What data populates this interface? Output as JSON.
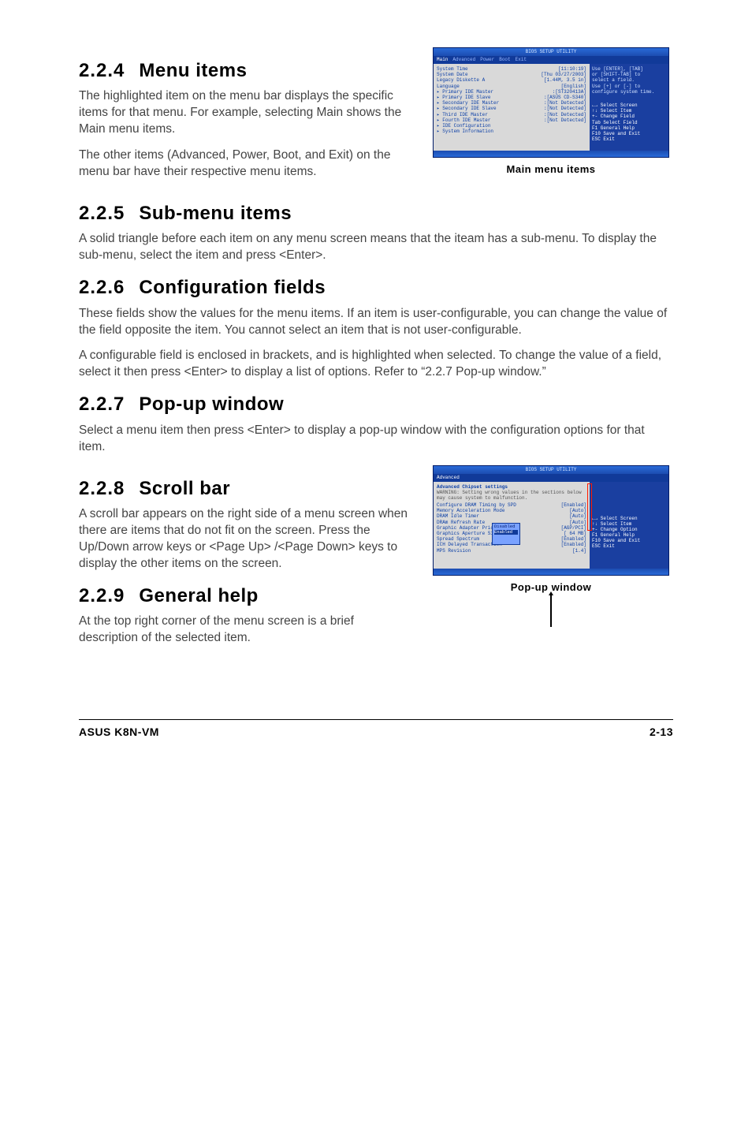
{
  "sections": {
    "s224": {
      "num": "2.2.4",
      "title": "Menu items",
      "p1": "The highlighted item on the menu bar displays the specific items for that menu. For example, selecting Main shows the Main menu items.",
      "p2": "The other items (Advanced, Power, Boot, and Exit) on the menu bar have their respective menu items."
    },
    "s225": {
      "num": "2.2.5",
      "title": "Sub-menu items",
      "p1": "A solid triangle before each item on any menu screen means that the iteam has a sub-menu. To display the sub-menu, select the item and press <Enter>."
    },
    "s226": {
      "num": "2.2.6",
      "title": "Configuration fields",
      "p1": "These fields show the values for the menu items. If an item is user-configurable, you can change the value of the field opposite the item. You cannot select an item that is not user-configurable.",
      "p2": "A configurable field is enclosed in brackets, and is highlighted when selected. To change the value of a field, select it then press <Enter> to display a list of options. Refer to “2.2.7 Pop-up window.”"
    },
    "s227": {
      "num": "2.2.7",
      "title": "Pop-up window",
      "p1": "Select a menu item then press <Enter> to display a pop-up window with the configuration options for that item."
    },
    "s228": {
      "num": "2.2.8",
      "title": "Scroll bar",
      "p1": "A scroll bar appears on the right side of a menu screen when there are items that do not fit on the screen. Press the Up/Down arrow keys or <Page Up> /<Page Down> keys to display the other items on the screen."
    },
    "s229": {
      "num": "2.2.9",
      "title": "General help",
      "p1": "At the top right corner of the menu screen is a brief description of the selected item."
    }
  },
  "captions": {
    "main_menu_items": "Main menu items",
    "popup_window": "Pop-up window"
  },
  "bios1": {
    "titlebar": "BIOS SETUP UTILITY",
    "tabs": [
      "Main",
      "Advanced",
      "Power",
      "Boot",
      "Exit"
    ],
    "left": [
      {
        "l": "System Time",
        "r": "[11:10:19]"
      },
      {
        "l": "System Date",
        "r": "[Thu 03/27/2003]"
      },
      {
        "l": "Legacy Diskette A",
        "r": "[1.44M, 3.5 in]"
      },
      {
        "l": "Language",
        "r": "[English]"
      },
      {
        "l": "",
        "r": ""
      },
      {
        "l": "▸ Primary IDE Master",
        "r": ":[ST320413A]"
      },
      {
        "l": "▸ Primary IDE Slave",
        "r": ":[ASUS CD-S340]"
      },
      {
        "l": "▸ Secondary IDE Master",
        "r": ":[Not Detected]"
      },
      {
        "l": "▸ Secondary IDE Slave",
        "r": ":[Not Detected]"
      },
      {
        "l": "▸ Third IDE Master",
        "r": ":[Not Detected]"
      },
      {
        "l": "▸ Fourth IDE Master",
        "r": ":[Not Detected]"
      },
      {
        "l": "▸ IDE Configuration",
        "r": ""
      },
      {
        "l": "",
        "r": ""
      },
      {
        "l": "▸ System Information",
        "r": ""
      }
    ],
    "right_help": [
      "Use [ENTER], [TAB]",
      "or [SHIFT-TAB] to",
      "select a field.",
      "",
      "Use [+] or [-] to",
      "configure system time."
    ],
    "right_keys": [
      "←→  Select Screen",
      "↑↓  Select Item",
      "+-    Change Field",
      "Tab  Select Field",
      "F1   General Help",
      "F10  Save and Exit",
      "ESC  Exit"
    ]
  },
  "bios2": {
    "titlebar": "BIOS SETUP UTILITY",
    "tabs_active": "Advanced",
    "heading": "Advanced Chipset settings",
    "warning": "WARNING: Setting wrong values in the sections below may cause system to malfunction.",
    "left": [
      {
        "l": "Configure DRAM Timing by SPD",
        "r": "[Enabled]"
      },
      {
        "l": "Memory Acceleration Mode",
        "r": "[Auto]"
      },
      {
        "l": "DRAM Idle Timer",
        "r": "[Auto]"
      },
      {
        "l": "DRAm Refresh Rate",
        "r": "[Auto]"
      },
      {
        "l": "",
        "r": ""
      },
      {
        "l": "Graphic Adapter Priority",
        "r": "[AGP/PCI]"
      },
      {
        "l": "Graphics Aperture Size",
        "r": "[ 64 MB]"
      },
      {
        "l": "Spread Spectrum",
        "r": "[Enabled]"
      },
      {
        "l": "",
        "r": ""
      },
      {
        "l": "ICH Delayed Transaction",
        "r": "[Enabled]"
      },
      {
        "l": "",
        "r": ""
      },
      {
        "l": "MPS Revision",
        "r": "[1.4]"
      }
    ],
    "popup_options": [
      "Disabled",
      "Enabled"
    ],
    "right_keys": [
      "←→  Select Screen",
      "↑↓  Select Item",
      "+-    Change Option",
      "F1   General Help",
      "F10  Save and Exit",
      "ESC  Exit"
    ]
  },
  "footer": {
    "left": "ASUS K8N-VM",
    "right": "2-13"
  }
}
